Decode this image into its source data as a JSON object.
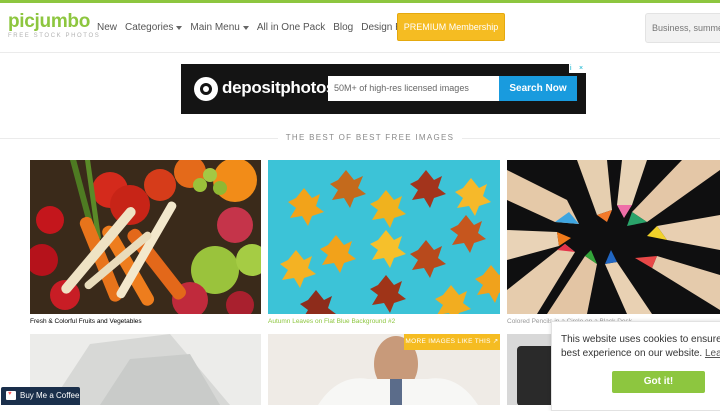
{
  "brand": {
    "name": "picjumbo",
    "tagline": "FREE STOCK PHOTOS"
  },
  "nav": {
    "items": [
      {
        "label": "New",
        "caret": false
      },
      {
        "label": "Categories",
        "caret": true
      },
      {
        "label": "Main Menu",
        "caret": true
      },
      {
        "label": "All in One Pack",
        "caret": false
      },
      {
        "label": "Blog",
        "caret": false
      },
      {
        "label": "Design Resources",
        "caret": false
      }
    ],
    "premium_label": "PREMIUM Membership",
    "search_placeholder": "Business, summer"
  },
  "ad": {
    "brand": "depositphotos",
    "input_text": "50M+ of high-res licensed images",
    "button_label": "Search Now",
    "info_glyph": "i",
    "close_glyph": "×"
  },
  "section": {
    "title": "THE BEST OF BEST FREE IMAGES"
  },
  "images": [
    {
      "caption": "Fresh & Colorful Fruits and Vegetables",
      "caption_color": "#999999"
    },
    {
      "caption": "Autumn Leaves on Flat Blue Background #2",
      "caption_color": "#8dc63f"
    },
    {
      "caption": "Colored Pencils in a Circle on a Black Desk",
      "caption_color": "#999999"
    }
  ],
  "more_images_label": "MORE IMAGES LIKE THIS ↗",
  "cookie": {
    "text_line1": "This website uses cookies to ensure you",
    "text_line2": "best experience on our website.",
    "learn_more": "Learn m",
    "button_label": "Got it!"
  },
  "coffee": {
    "label": "Buy Me a Coffee"
  },
  "colors": {
    "accent": "#8dc63f",
    "premium": "#f5bc22",
    "ad_button": "#199bde"
  }
}
